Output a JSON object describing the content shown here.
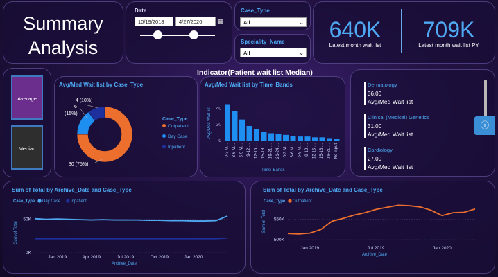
{
  "header": {
    "title_line1": "Summary",
    "title_line2": "Analysis"
  },
  "date_filter": {
    "label": "Date",
    "start": "10/19/2018",
    "end": "4/27/2020"
  },
  "case_type_filter": {
    "label": "Case_Type",
    "value": "All"
  },
  "speciality_filter": {
    "label": "Speciality_Name",
    "value": "All"
  },
  "kpis": [
    {
      "value": "640K",
      "caption": "Latest month wait list"
    },
    {
      "value": "709K",
      "caption": "Latest month wait list PY"
    }
  ],
  "indicator": {
    "title": "Indicator(Patient wait list Median)",
    "buttons": [
      "Average",
      "Median"
    ]
  },
  "donut_chart": {
    "title": "Avg/Med Wait list by Case_Type",
    "legend_title": "Case_Type",
    "labels": [
      "4 (10%)",
      "6",
      "(15%)",
      "30 (75%)"
    ],
    "colors": {
      "Outpatient": "#ec6f2d",
      "Day Case": "#1f8ef1",
      "Inpatient": "#1e2f9e"
    }
  },
  "bar_chart": {
    "title": "Avg/Med Wait list by Time_Bands",
    "xlabel": "Time_Bands",
    "ylabel": "Avg/Med Wait list"
  },
  "specialities": [
    {
      "name": "Dermatology",
      "value": "36.00",
      "caption": "Avg/Med Wait list"
    },
    {
      "name": "Clinical (Medical) Genetics",
      "value": "31.00",
      "caption": "Avg/Med Wait list"
    },
    {
      "name": "Cardiology",
      "value": "27.00",
      "caption": "Avg/Med Wait list"
    }
  ],
  "line_left": {
    "title": "Sum of Total by Archive_Date and Case_Type",
    "legend_title": "Case_Type",
    "xlabel": "Archive_Date",
    "ylabel": "Sum of Total"
  },
  "line_right": {
    "title": "Sum of Total by Archive_Date and Case_Type",
    "legend_title": "Case_Type",
    "xlabel": "Archive_Date",
    "ylabel": "Sum of Total"
  },
  "chart_data": [
    {
      "type": "pie",
      "title": "Avg/Med Wait list by Case_Type",
      "categories": [
        "Outpatient",
        "Day Case",
        "Inpatient"
      ],
      "values": [
        30,
        6,
        4
      ],
      "legend": "right",
      "colors": [
        "#ec6f2d",
        "#1f8ef1",
        "#1e2f9e"
      ]
    },
    {
      "type": "bar",
      "title": "Avg/Med Wait list by Time_Bands",
      "categories": [
        "0-3 M...",
        "3-6 M...",
        "6-9 M...",
        "9-12 ...",
        "12-15 ...",
        "15-18 ...",
        "18-21 ...",
        "21-24 ...",
        "0-3 M...",
        "3-6 M...",
        "6-9 M...",
        "9-12 ...",
        "12-15 ...",
        "15-18 ...",
        "18-21 ...",
        "No input"
      ],
      "values": [
        45,
        36,
        26,
        18,
        14,
        11,
        9,
        8,
        7,
        6,
        5,
        5,
        4,
        4,
        3,
        2
      ],
      "yticks": [
        0,
        20,
        40
      ],
      "ylim": [
        0,
        48
      ],
      "xlabel": "Time_Bands",
      "ylabel": "Avg/Med Wait list",
      "color": "#1f8ef1"
    },
    {
      "type": "line",
      "title": "Sum of Total by Archive_Date and Case_Type",
      "x": [
        "Nov 2018",
        "Dec 2018",
        "Jan 2019",
        "Feb 2019",
        "Mar 2019",
        "Apr 2019",
        "May 2019",
        "Jun 2019",
        "Jul 2019",
        "Aug 2019",
        "Sep 2019",
        "Oct 2019",
        "Nov 2019",
        "Dec 2019",
        "Jan 2020",
        "Feb 2020",
        "Mar 2020",
        "Apr 2020"
      ],
      "series": [
        {
          "name": "Day Case",
          "color": "#4fa9f2",
          "values": [
            51000,
            50000,
            50500,
            50000,
            49500,
            49000,
            49500,
            49000,
            49000,
            49000,
            48500,
            48500,
            48000,
            48000,
            47500,
            47500,
            48000,
            55000
          ]
        },
        {
          "name": "Inpatient",
          "color": "#1e2f9e",
          "values": [
            21000,
            21000,
            21000,
            21000,
            21000,
            21000,
            21000,
            21000,
            21000,
            21000,
            21000,
            21000,
            21000,
            21000,
            21000,
            21000,
            21000,
            22000
          ]
        }
      ],
      "x_ticks": [
        "Jan 2019",
        "Apr 2019",
        "Jul 2019",
        "Oct 2019",
        "Jan 2020"
      ],
      "y_ticks": [
        "0K",
        "50K"
      ],
      "ylim": [
        0,
        60000
      ],
      "xlabel": "Archive_Date",
      "ylabel": "Sum of Total",
      "legend": "top-left"
    },
    {
      "type": "line",
      "title": "Sum of Total by Archive_Date and Case_Type",
      "x": [
        "Nov 2018",
        "Dec 2018",
        "Jan 2019",
        "Feb 2019",
        "Mar 2019",
        "Apr 2019",
        "May 2019",
        "Jun 2019",
        "Jul 2019",
        "Aug 2019",
        "Sep 2019",
        "Oct 2019",
        "Nov 2019",
        "Dec 2019",
        "Jan 2020",
        "Feb 2020",
        "Mar 2020",
        "Apr 2020"
      ],
      "series": [
        {
          "name": "Outpatient",
          "color": "#ec6f2d",
          "values": [
            515000,
            514000,
            516000,
            525000,
            545000,
            552000,
            560000,
            566000,
            574000,
            579000,
            584000,
            583000,
            580000,
            572000,
            559000,
            566000,
            567000,
            575000
          ]
        }
      ],
      "x_ticks": [
        "Jan 2019",
        "Jul 2019",
        "Jan 2020"
      ],
      "y_ticks": [
        "500K",
        "550K"
      ],
      "ylim": [
        490000,
        600000
      ],
      "xlabel": "Archive_Date",
      "ylabel": "Sum of Total",
      "legend": "top-left"
    }
  ]
}
